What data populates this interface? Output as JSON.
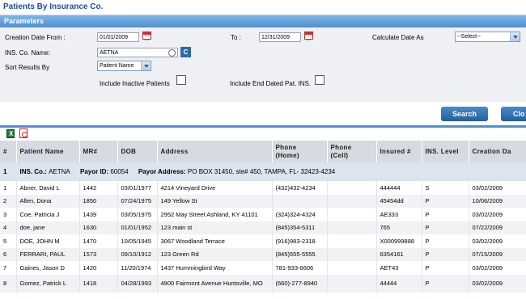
{
  "header": {
    "title": "Patients By Insurance Co."
  },
  "params": {
    "section_title": "Parameters",
    "creation_date_from_label": "Creation Date From :",
    "creation_date_from": "01/01/2009",
    "to_label": "To :",
    "to_date": "12/31/2009",
    "calculate_date_as_label": "Calculate Date As",
    "calculate_date_as": "--Select--",
    "ins_co_name_label": "INS. Co. Name:",
    "ins_co_name": "AETNA",
    "c_button": "C",
    "sort_results_by_label": "Sort Results By",
    "sort_results_by": "Patient Name",
    "include_inactive_label": "Include Inactive Patients",
    "include_end_dated_label": "Include End Dated Pat. INS."
  },
  "buttons": {
    "search": "Search",
    "close": "Clo"
  },
  "table": {
    "columns": [
      "#",
      "Patient Name",
      "MR#",
      "DOB",
      "Address",
      "Phone (Home)",
      "Phone (Cell)",
      "Insured #",
      "INS. Level",
      "Creation Da"
    ],
    "columns_split": {
      "phone_home_1": "Phone",
      "phone_home_2": "(Home)",
      "phone_cell_1": "Phone",
      "phone_cell_2": "(Cell)"
    },
    "group": {
      "num": "1",
      "ins_co_label": "INS. Co.:",
      "ins_co": "AETNA",
      "payor_id_label": "Payor ID:",
      "payor_id": "60054",
      "payor_address_label": "Payor Address:",
      "payor_address": "PO BOX 31450, ste# 450, TAMPA, FL- 32423-4234"
    },
    "rows": [
      {
        "num": "1",
        "name": "Abner, David L",
        "mr": "1442",
        "dob": "03/01/1977",
        "address": "4214 Vineyard Drive",
        "phone_home": "(432)432-4234",
        "phone_cell": "",
        "insured": "444444",
        "level": "S",
        "created": "03/02/2009"
      },
      {
        "num": "2",
        "name": "Allen, Dona",
        "mr": "1850",
        "dob": "07/24/1975",
        "address": "149 Yellow St",
        "phone_home": "",
        "phone_cell": "",
        "insured": "45454dd",
        "level": "P",
        "created": "10/06/2009"
      },
      {
        "num": "3",
        "name": "Coe, Patricia J",
        "mr": "1439",
        "dob": "03/05/1975",
        "address": "2952 May Street Ashland, KY 41101",
        "phone_home": "(324)324-4324",
        "phone_cell": "",
        "insured": "AE333",
        "level": "P",
        "created": "03/02/2009"
      },
      {
        "num": "4",
        "name": "doe, jane",
        "mr": "1630",
        "dob": "01/01/1952",
        "address": "123 main st",
        "phone_home": "(845)354-5311",
        "phone_cell": "",
        "insured": "765",
        "level": "P",
        "created": "07/22/2009"
      },
      {
        "num": "5",
        "name": "DOE, JOHN M",
        "mr": "1470",
        "dob": "10/05/1945",
        "address": "3067 Woodland Terrace",
        "phone_home": "(916)983-2318",
        "phone_cell": "",
        "insured": "X000999888",
        "level": "P",
        "created": "03/02/2009"
      },
      {
        "num": "6",
        "name": "FERRARI, PAUL",
        "mr": "1573",
        "dob": "09/10/1912",
        "address": "123 Green Rd",
        "phone_home": "(845)555-5555",
        "phone_cell": "",
        "insured": "6354161",
        "level": "P",
        "created": "07/15/2009"
      },
      {
        "num": "7",
        "name": "Gaines, Jason D",
        "mr": "1420",
        "dob": "11/20/1974",
        "address": "1437 Hummingbird Way",
        "phone_home": "781-933-6606",
        "phone_cell": "",
        "insured": "AET43",
        "level": "P",
        "created": "03/02/2009"
      },
      {
        "num": "8",
        "name": "Gomez, Patrick L",
        "mr": "1418",
        "dob": "04/28/1993",
        "address": "4900 Fairmont Avenue Huntsville, MO",
        "phone_home": "(660)-277-8940",
        "phone_cell": "",
        "insured": "44444",
        "level": "P",
        "created": "03/02/2009"
      }
    ]
  }
}
